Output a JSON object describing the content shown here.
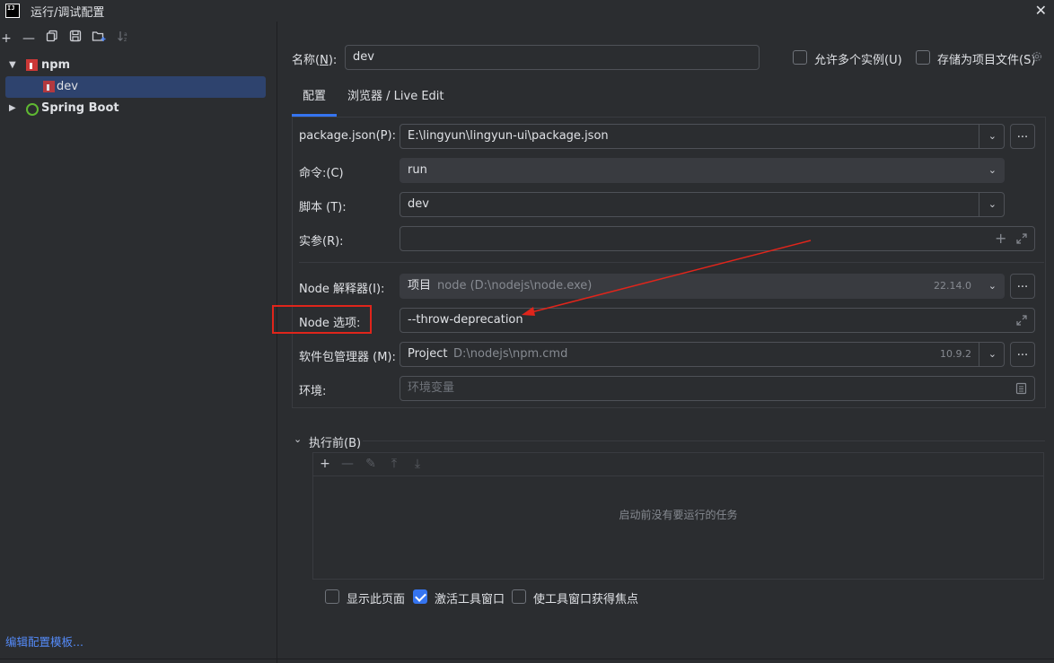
{
  "window": {
    "title": "运行/调试配置",
    "app_icon_text": "IJ"
  },
  "left_toolbar": {
    "icons": [
      "add-icon",
      "remove-icon",
      "copy-icon",
      "save-icon",
      "new-folder-icon",
      "sort-icon"
    ]
  },
  "tree": {
    "npm_label": "npm",
    "dev_label": "dev",
    "spring_label": "Spring Boot"
  },
  "edit_templates_link": "编辑配置模板...",
  "name_row": {
    "label": "名称(N):",
    "label_plain": "名称(",
    "label_mnemonic": "N",
    "label_tail": "):",
    "value": "dev",
    "allow_parallel_label": "允许多个实例(U)",
    "store_as_project_label": "存储为项目文件(S)"
  },
  "tabs": [
    {
      "label": "配置",
      "active": true
    },
    {
      "label": "浏览器 / Live Edit",
      "active": false
    }
  ],
  "form": {
    "package_json_label": "package.json(P):",
    "package_json_value": "E:\\lingyun\\lingyun-ui\\package.json",
    "command_label": "命令:(C)",
    "command_value": "run",
    "script_label": "脚本 (T):",
    "script_value": "dev",
    "args_label": "实参(R):",
    "args_value": "",
    "node_interpreter_label": "Node 解释器(I):",
    "node_interpreter_kind": "项目",
    "node_interpreter_path": "node (D:\\nodejs\\node.exe)",
    "node_interpreter_version": "22.14.0",
    "node_options_label": "Node 选项:",
    "node_options_value": "--throw-deprecation",
    "package_manager_label": "软件包管理器 (M):",
    "package_manager_kind": "Project",
    "package_manager_path": "D:\\nodejs\\npm.cmd",
    "package_manager_version": "10.9.2",
    "env_label": "环境:",
    "env_placeholder": "环境变量",
    "more_button": "..."
  },
  "before_launch": {
    "title": "执行前(B)",
    "empty_text": "启动前没有要运行的任务"
  },
  "bottom_options": {
    "show_page_label": "显示此页面",
    "activate_tool_window_label": "激活工具窗口",
    "focus_tool_window_label": "使工具窗口获得焦点",
    "activate_checked": true
  },
  "colors": {
    "background": "#2b2d30",
    "accent": "#3574f0",
    "selection": "#2e436e",
    "annotation_red": "#e0251b",
    "link": "#548af7"
  }
}
